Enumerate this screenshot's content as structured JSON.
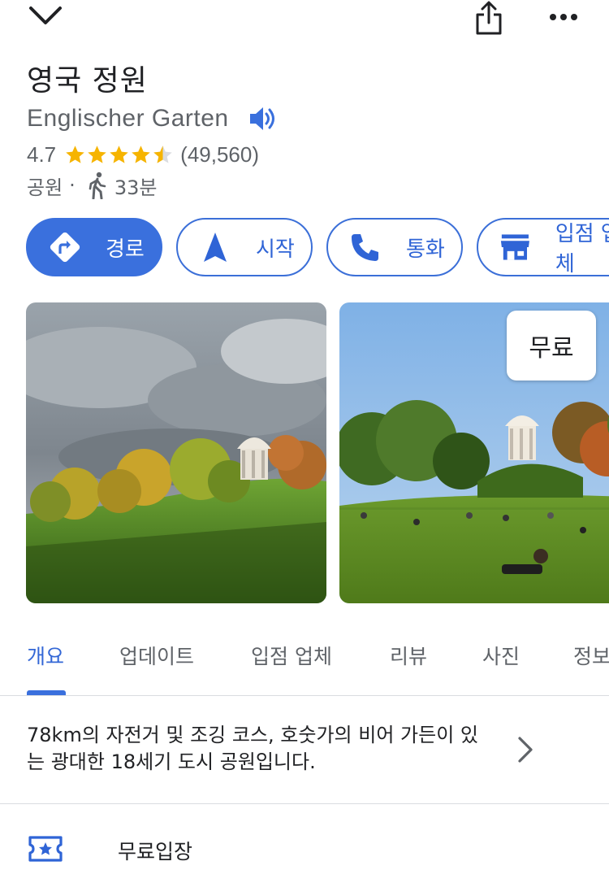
{
  "header": {
    "collapse_icon": "chevron-down-icon",
    "share_icon": "share-icon",
    "more_icon": "more-horizontal-icon"
  },
  "place": {
    "name": "영국 정원",
    "original_name": "Englischer Garten",
    "rating": "4.7",
    "stars_filled": 4.5,
    "review_count": "(49,560)",
    "category": "공원",
    "separator": "·",
    "walk_time": "33분"
  },
  "actions": [
    {
      "label": "경로",
      "icon": "directions-icon"
    },
    {
      "label": "시작",
      "icon": "navigation-arrow-icon"
    },
    {
      "label": "통화",
      "icon": "phone-icon"
    },
    {
      "label": "입점 업체",
      "icon": "storefront-icon"
    }
  ],
  "photos": {
    "badge": "무료"
  },
  "tabs": [
    "개요",
    "업데이트",
    "입점 업체",
    "리뷰",
    "사진",
    "정보"
  ],
  "active_tab": 0,
  "description": "78km의 자전거 및 조깅 코스, 호숫가의 비어 가든이 있는 광대한 18세기 도시 공원입니다.",
  "admission": {
    "label": "무료입장",
    "icon": "ticket-icon"
  },
  "colors": {
    "accent": "#3a70dd",
    "star": "#f6b400",
    "text_secondary": "#5f6368"
  }
}
